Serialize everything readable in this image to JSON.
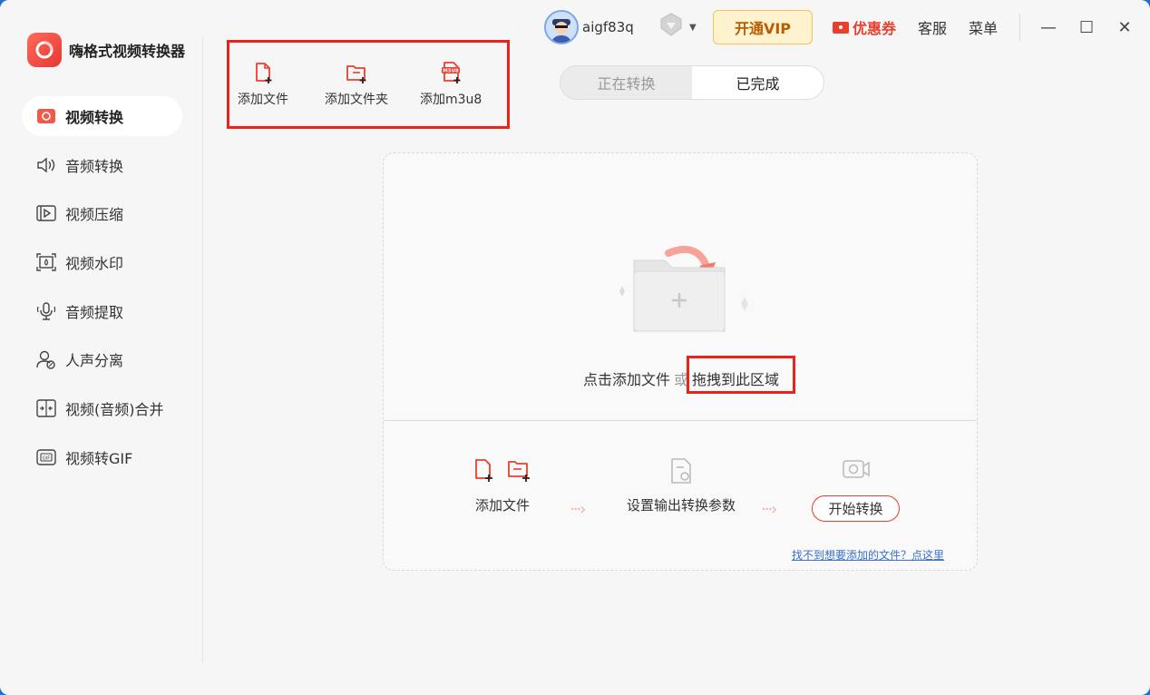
{
  "app": {
    "name": "嗨格式视频转换器"
  },
  "sidebar": {
    "items": [
      {
        "label": "视频转换",
        "icon": "video-convert-icon",
        "active": true
      },
      {
        "label": "音频转换",
        "icon": "speaker-icon",
        "active": false
      },
      {
        "label": "视频压缩",
        "icon": "compress-icon",
        "active": false
      },
      {
        "label": "视频水印",
        "icon": "watermark-icon",
        "active": false
      },
      {
        "label": "音频提取",
        "icon": "microphone-icon",
        "active": false
      },
      {
        "label": "人声分离",
        "icon": "voice-separate-icon",
        "active": false
      },
      {
        "label": "视频(音频)合并",
        "icon": "merge-icon",
        "active": false
      },
      {
        "label": "视频转GIF",
        "icon": "gif-icon",
        "active": false
      }
    ]
  },
  "topbar": {
    "username": "aigf83q",
    "vip_label": "开通VIP",
    "coupon_label": "优惠券",
    "service_label": "客服",
    "menu_label": "菜单",
    "minimize": "—",
    "maximize": "☐",
    "close": "✕"
  },
  "toolbar": {
    "add_file": "添加文件",
    "add_folder": "添加文件夹",
    "add_m3u8": "添加m3u8"
  },
  "tabs": [
    {
      "label": "正在转换",
      "active": false
    },
    {
      "label": "已完成",
      "active": true
    }
  ],
  "dropzone": {
    "prompt_click": "点击添加文件",
    "prompt_or": "或",
    "prompt_drag": "拖拽到此区域",
    "step1": "添加文件",
    "step2": "设置输出转换参数",
    "step3": "开始转换",
    "help_link": "找不到想要添加的文件？点这里"
  },
  "colors": {
    "accent": "#e8402f",
    "highlight_box": "#e8241a",
    "vip_text": "#b85d00"
  }
}
